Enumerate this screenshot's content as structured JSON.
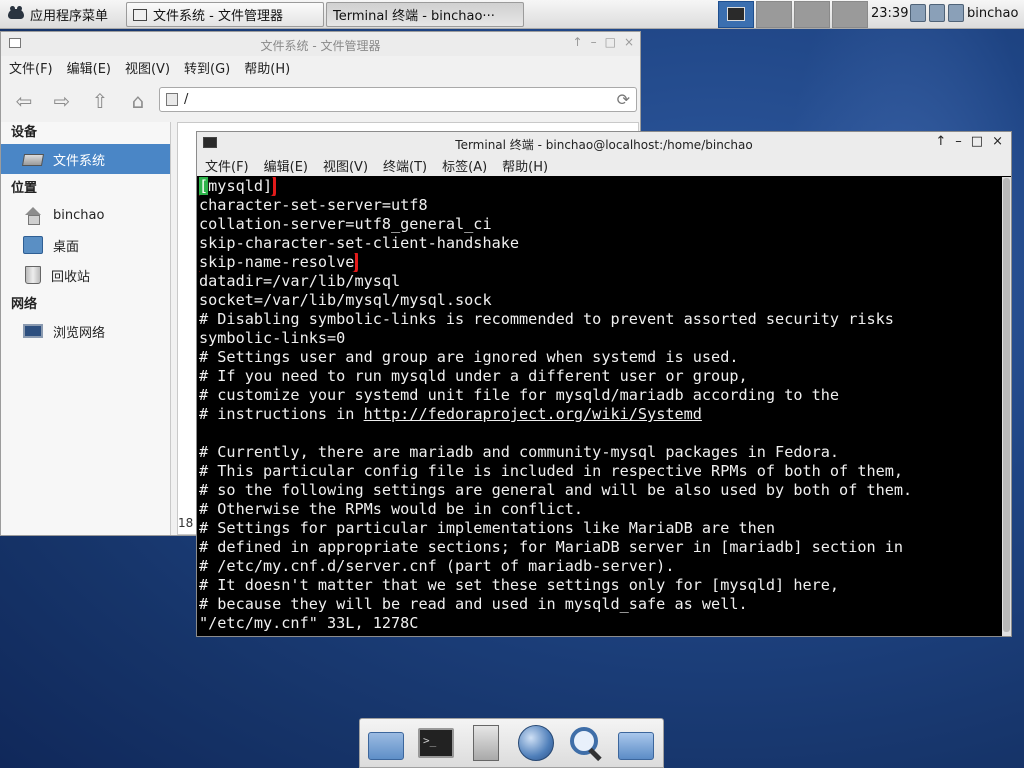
{
  "panel": {
    "app_menu_label": "应用程序菜单",
    "tasks": [
      {
        "label": "文件系统 - 文件管理器"
      },
      {
        "label": "Terminal 终端 - binchao···"
      }
    ],
    "clock": "23:39",
    "user": "binchao"
  },
  "file_manager": {
    "title": "文件系统 - 文件管理器",
    "menu": [
      "文件(F)",
      "编辑(E)",
      "视图(V)",
      "转到(G)",
      "帮助(H)"
    ],
    "location": "/",
    "sidebar": {
      "sections": [
        {
          "heading": "设备",
          "items": [
            {
              "label": "文件系统",
              "icon": "drive-icon",
              "selected": true
            }
          ]
        },
        {
          "heading": "位置",
          "items": [
            {
              "label": "binchao",
              "icon": "home-icon"
            },
            {
              "label": "桌面",
              "icon": "desktop-icon"
            },
            {
              "label": "回收站",
              "icon": "trash-icon"
            }
          ]
        },
        {
          "heading": "网络",
          "items": [
            {
              "label": "浏览网络",
              "icon": "network-icon"
            }
          ]
        }
      ]
    },
    "status_partial": "18"
  },
  "terminal": {
    "title": "Terminal 终端 - binchao@localhost:/home/binchao",
    "menu": [
      "文件(F)",
      "编辑(E)",
      "视图(V)",
      "终端(T)",
      "标签(A)",
      "帮助(H)"
    ],
    "line0_cursor": "[",
    "line0_rest": "mysqld]",
    "lines": [
      "character-set-server=utf8",
      "collation-server=utf8_general_ci",
      "skip-character-set-client-handshake",
      "skip-name-resolve",
      "datadir=/var/lib/mysql",
      "socket=/var/lib/mysql/mysql.sock",
      "# Disabling symbolic-links is recommended to prevent assorted security risks",
      "symbolic-links=0",
      "# Settings user and group are ignored when systemd is used.",
      "# If you need to run mysqld under a different user or group,",
      "# customize your systemd unit file for mysqld/mariadb according to the",
      "",
      "",
      "# Currently, there are mariadb and community-mysql packages in Fedora.",
      "# This particular config file is included in respective RPMs of both of them,",
      "# so the following settings are general and will be also used by both of them.",
      "# Otherwise the RPMs would be in conflict.",
      "# Settings for particular implementations like MariaDB are then",
      "# defined in appropriate sections; for MariaDB server in [mariadb] section in",
      "# /etc/my.cnf.d/server.cnf (part of mariadb-server).",
      "# It doesn't matter that we set these settings only for [mysqld] here,",
      "# because they will be read and used in mysqld_safe as well.",
      "\"/etc/my.cnf\" 33L, 1278C"
    ],
    "instructions_prefix": "# instructions in ",
    "instructions_link": "http://fedoraproject.org/wiki/Systemd",
    "highlight_color": "#e31b1b",
    "cursor_color": "#2db34a"
  }
}
